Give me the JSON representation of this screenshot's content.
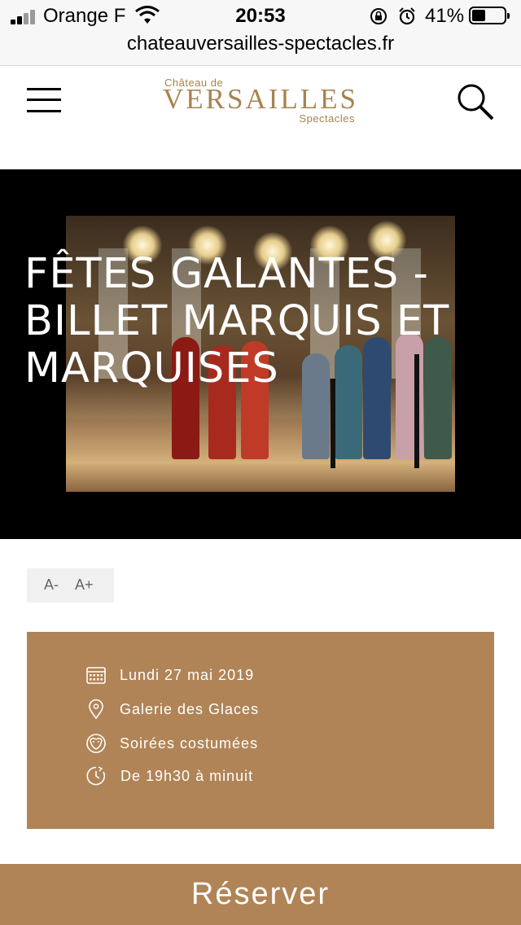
{
  "status_bar": {
    "carrier": "Orange F",
    "time": "20:53",
    "battery_percent": "41%",
    "battery_level": 0.41,
    "url": "chateauversailles-spectacles.fr"
  },
  "header": {
    "logo_top": "Château de",
    "logo_main": "VERSAILLES",
    "logo_bottom": "Spectacles"
  },
  "hero": {
    "title": "FÊTES GALANTES - BILLET MARQUIS ET MARQUISES"
  },
  "font_controls": {
    "decrease": "A-",
    "increase": "A+"
  },
  "event_info": [
    {
      "icon": "calendar-icon",
      "text": "Lundi 27 mai 2019"
    },
    {
      "icon": "location-pin-icon",
      "text": "Galerie des Glaces"
    },
    {
      "icon": "theater-masks-icon",
      "text": "Soirées costumées"
    },
    {
      "icon": "clock-icon",
      "text": "De 19h30 à minuit"
    }
  ],
  "reserve_button": {
    "label": "Réserver"
  },
  "colors": {
    "accent": "#b08457",
    "logo_gold": "#a8834e",
    "hero_background": "#000000"
  }
}
